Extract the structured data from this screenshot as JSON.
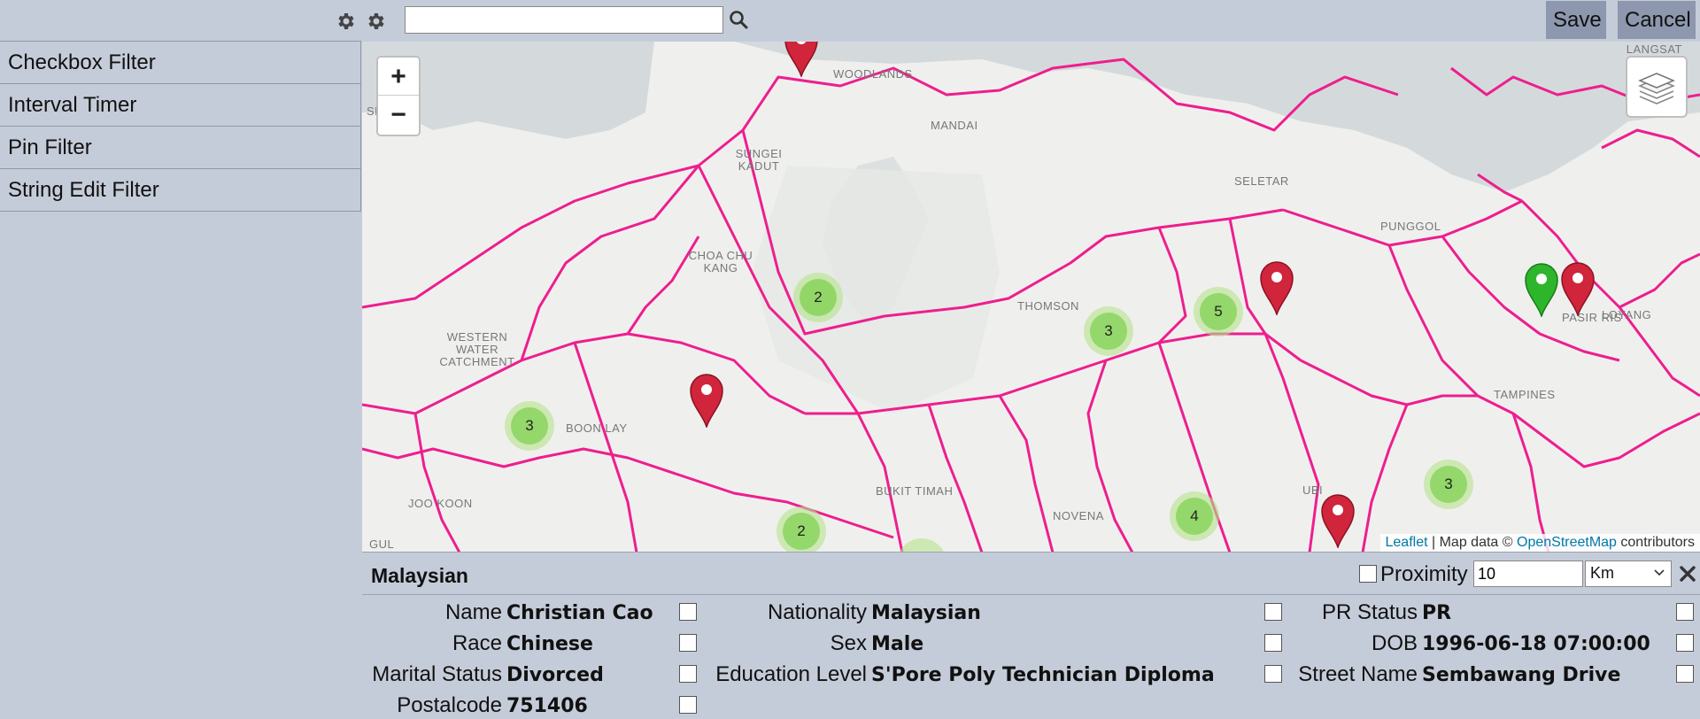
{
  "sidebar": {
    "items": [
      {
        "label": "Checkbox Filter"
      },
      {
        "label": "Interval Timer"
      },
      {
        "label": "Pin Filter"
      },
      {
        "label": "String Edit Filter"
      }
    ]
  },
  "search": {
    "value": "",
    "placeholder": ""
  },
  "toolbar": {
    "save_label": "Save",
    "cancel_label": "Cancel"
  },
  "map": {
    "zoom_in": "+",
    "zoom_out": "−",
    "labels": [
      "LANGSAT",
      "WOODLANDS",
      "SUNGEI KADUT",
      "SELETAR",
      "PUNGGOL",
      "CHOA CHU KANG",
      "THOMSON",
      "PASIR RIS",
      "LOYANG",
      "WESTERN WATER CATCHMENT",
      "TAMPINES",
      "BOON LAY",
      "BUKIT TIMAH",
      "NOVENA",
      "UBI",
      "JOO KOON",
      "GUL",
      "SENOKO",
      "MANDAI"
    ],
    "clusters": [
      "2",
      "3",
      "5",
      "3",
      "3",
      "4",
      "2"
    ],
    "attribution": {
      "leaflet": "Leaflet",
      "mid": "| Map data ©",
      "osm": "OpenStreetMap",
      "end": "contributors"
    },
    "colors": {
      "boundary": "#ee1e8e",
      "cluster_outer": "#b5e28c",
      "cluster_inner": "#6ecc39",
      "pin_red": "#d0253a",
      "pin_green": "#2db62c"
    }
  },
  "panel": {
    "title": "Malaysian",
    "proximity_label": "Proximity",
    "proximity_value": "10",
    "proximity_unit": "Km",
    "fields": [
      {
        "label": "Name",
        "value": "Christian Cao"
      },
      {
        "label": "Nationality",
        "value": "Malaysian"
      },
      {
        "label": "PR Status",
        "value": "PR"
      },
      {
        "label": "Race",
        "value": "Chinese"
      },
      {
        "label": "Sex",
        "value": "Male"
      },
      {
        "label": "DOB",
        "value": "1996-06-18 07:00:00"
      },
      {
        "label": "Marital Status",
        "value": "Divorced"
      },
      {
        "label": "Education Level",
        "value": "S'Pore Poly Technician Diploma"
      },
      {
        "label": "Street Name",
        "value": "Sembawang Drive"
      },
      {
        "label": "Postalcode",
        "value": "751406"
      }
    ]
  }
}
